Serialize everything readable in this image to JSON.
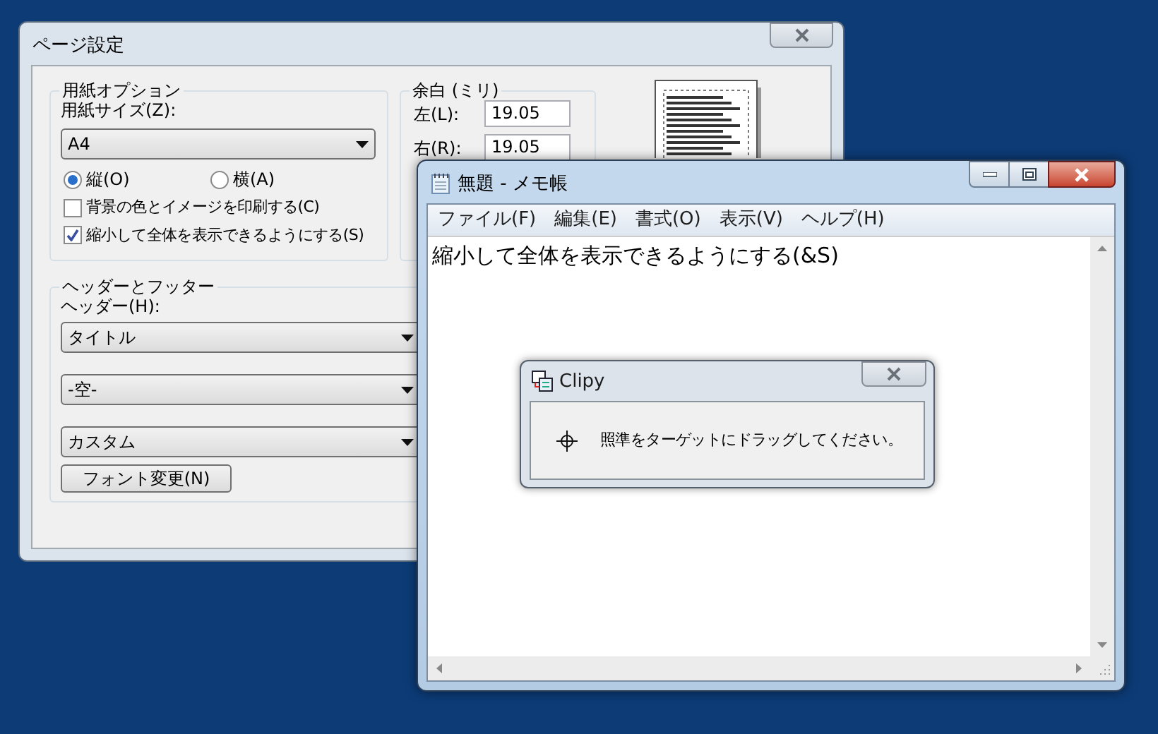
{
  "page_setup": {
    "title": "ページ設定",
    "paper": {
      "legend": "用紙オプション",
      "size_label": "用紙サイズ(Z):",
      "size_value": "A4",
      "orientations": [
        {
          "label": "縦(O)",
          "selected": true
        },
        {
          "label": "横(A)",
          "selected": false
        }
      ],
      "options": [
        {
          "label": "背景の色とイメージを印刷する(C)",
          "checked": false
        },
        {
          "label": "縮小して全体を表示できるようにする(S)",
          "checked": true
        }
      ]
    },
    "margins": {
      "legend": "余白 (ミリ)",
      "fields": [
        {
          "label": "左(L):",
          "value": "19.05"
        },
        {
          "label": "右(R):",
          "value": "19.05"
        }
      ]
    },
    "header_footer": {
      "legend": "ヘッダーとフッター",
      "header_label": "ヘッダー(H):",
      "dropdowns": [
        "タイトル",
        "-空-",
        "カスタム"
      ],
      "font_button": "フォント変更(N)"
    }
  },
  "notepad": {
    "title": "無題 - メモ帳",
    "menu": [
      "ファイル(F)",
      "編集(E)",
      "書式(O)",
      "表示(V)",
      "ヘルプ(H)"
    ],
    "text": "縮小して全体を表示できるようにする(&S)"
  },
  "clipy": {
    "title": "Clipy",
    "message": "照準をターゲットにドラッグしてください。"
  }
}
